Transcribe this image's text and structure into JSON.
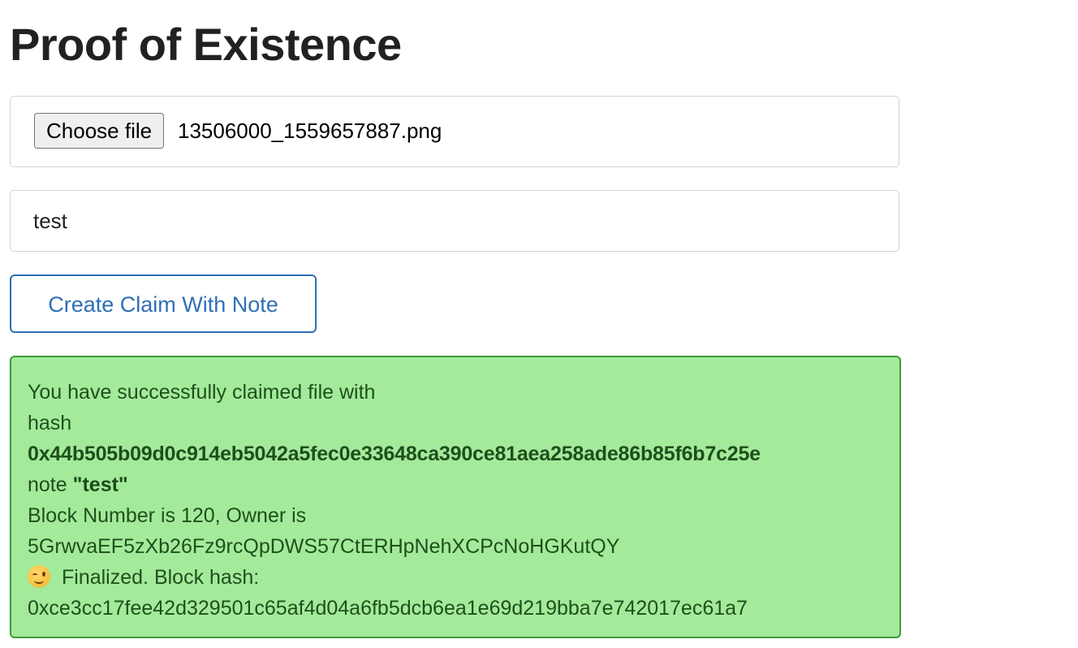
{
  "page": {
    "title": "Proof of Existence"
  },
  "file_input": {
    "button_label": "Choose file",
    "file_name": "13506000_1559657887.png"
  },
  "note_input": {
    "value": "test",
    "placeholder": ""
  },
  "actions": {
    "create_claim_label": "Create Claim With Note"
  },
  "status": {
    "line1": "You have successfully claimed file with",
    "hash_label": "hash",
    "file_hash": "0x44b505b09d0c914eb5042a5fec0e33648ca390ce81aea258ade86b85f6b7c25e",
    "note_label": "note",
    "note_value": "\"test\"",
    "block_line": "Block Number is 120, Owner is",
    "owner": "5GrwvaEF5zXb26Fz9rcQpDWS57CtERHpNehXCPcNoHGKutQY",
    "finalized_icon": "wink-emoji-icon",
    "finalized_text": "Finalized. Block hash:",
    "block_hash": "0xce3cc17fee42d329501c65af4d04a6fb5dcb6ea1e69d219bba7e742017ec61a7"
  },
  "colors": {
    "primary": "#2f6fb7",
    "success_bg": "#a4ea9b",
    "success_border": "#3f9a37",
    "success_text": "#1f4f1c"
  }
}
